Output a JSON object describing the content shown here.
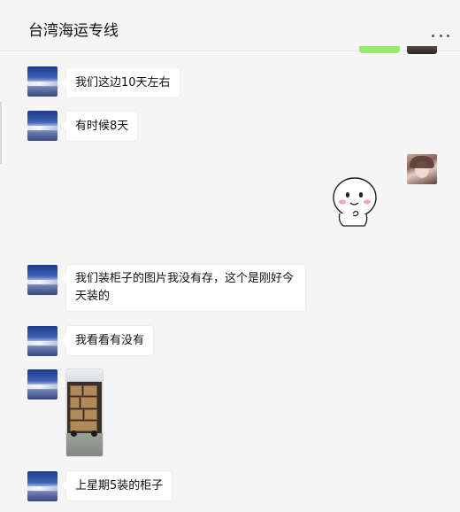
{
  "window": {
    "title": "台湾海运专线",
    "controls": [
      "pin-icon",
      "minimize-icon",
      "maximize-icon",
      "close-icon"
    ]
  },
  "colors": {
    "background": "#f5f5f5",
    "bubble_peer": "#ffffff",
    "bubble_self": "#95ec69"
  },
  "messages": [
    {
      "sender": "peer",
      "type": "text",
      "text": "我们这边10天左右"
    },
    {
      "sender": "peer",
      "type": "text",
      "text": "有时候8天"
    },
    {
      "sender": "self",
      "type": "sticker",
      "sticker": "smiling-face-sticker"
    },
    {
      "sender": "peer",
      "type": "text",
      "text": "我们装柜子的图片我没有存，这个是刚好今天装的"
    },
    {
      "sender": "peer",
      "type": "text",
      "text": "我看看有没有"
    },
    {
      "sender": "peer",
      "type": "image",
      "image": "loaded-container-photo"
    },
    {
      "sender": "peer",
      "type": "text",
      "text": "上星期5装的柜子"
    }
  ]
}
